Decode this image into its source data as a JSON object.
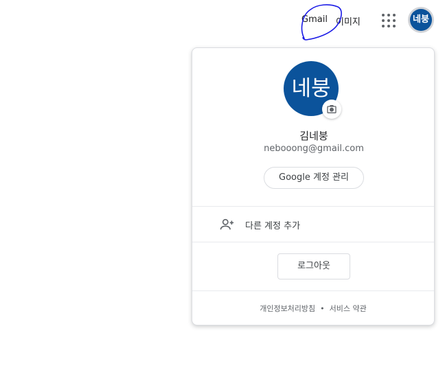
{
  "topbar": {
    "gmail_label": "Gmail",
    "images_label": "이미지",
    "avatar_initials": "네붕"
  },
  "account_card": {
    "avatar_initials": "네붕",
    "name": "김네붕",
    "email": "nebooong@gmail.com",
    "manage_label": "Google 계정 관리",
    "add_account_label": "다른 계정 추가",
    "logout_label": "로그아웃",
    "footer": {
      "privacy_label": "개인정보처리방침",
      "separator": "•",
      "terms_label": "서비스 약관"
    }
  },
  "colors": {
    "avatar_bg": "#0b539b",
    "scribble": "#1a1ae6",
    "border": "#dadce0"
  },
  "icons": {
    "apps": "grid-icon",
    "camera": "camera-icon",
    "add_account": "person-add-icon"
  }
}
